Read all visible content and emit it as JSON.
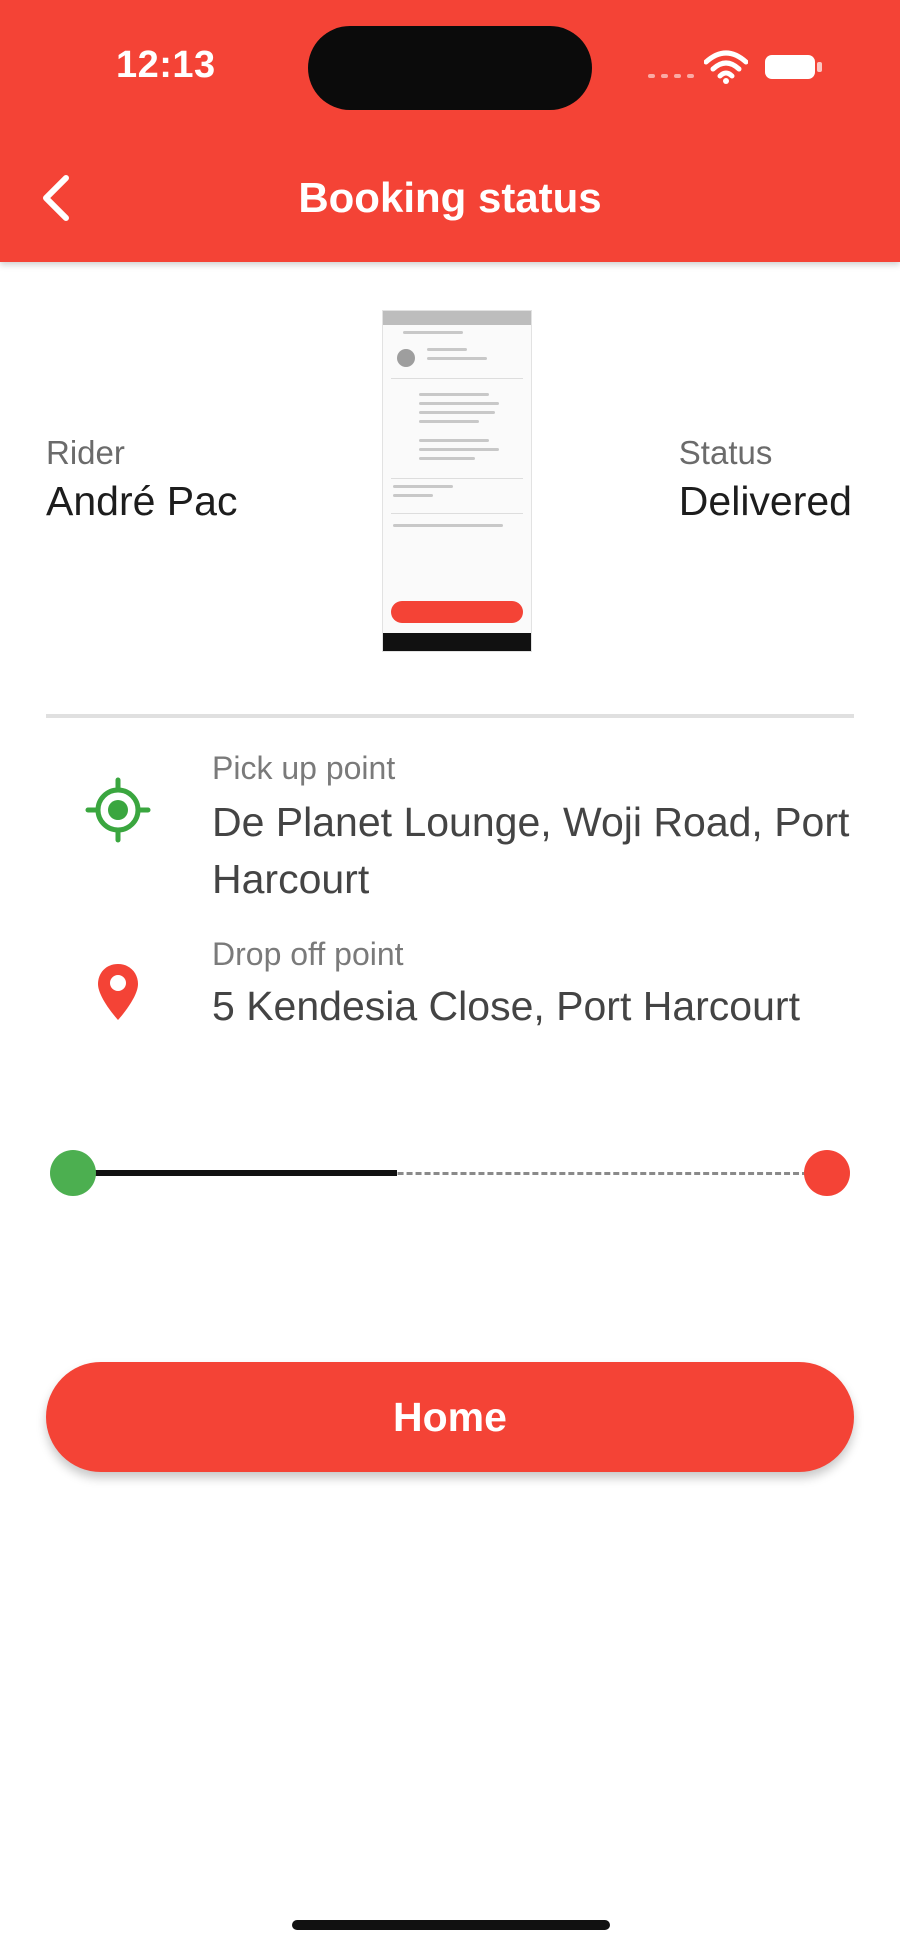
{
  "status_bar": {
    "time": "12:13"
  },
  "header": {
    "title": "Booking status",
    "back_icon": "chevron-left-icon"
  },
  "rider": {
    "label": "Rider",
    "name": "André Pac"
  },
  "booking_status": {
    "label": "Status",
    "value": "Delivered"
  },
  "route": {
    "pickup": {
      "label": "Pick up point",
      "address": "De Planet Lounge, Woji Road, Port Harcourt",
      "icon": "target-icon"
    },
    "dropoff": {
      "label": "Drop off point",
      "address": "5 Kendesia Close, Port Harcourt",
      "icon": "map-pin-icon"
    }
  },
  "progress": {
    "fraction": 0.43
  },
  "actions": {
    "home_label": "Home"
  },
  "colors": {
    "brand": "#f44336",
    "pickup": "#4caf50",
    "dropoff": "#f44336"
  }
}
